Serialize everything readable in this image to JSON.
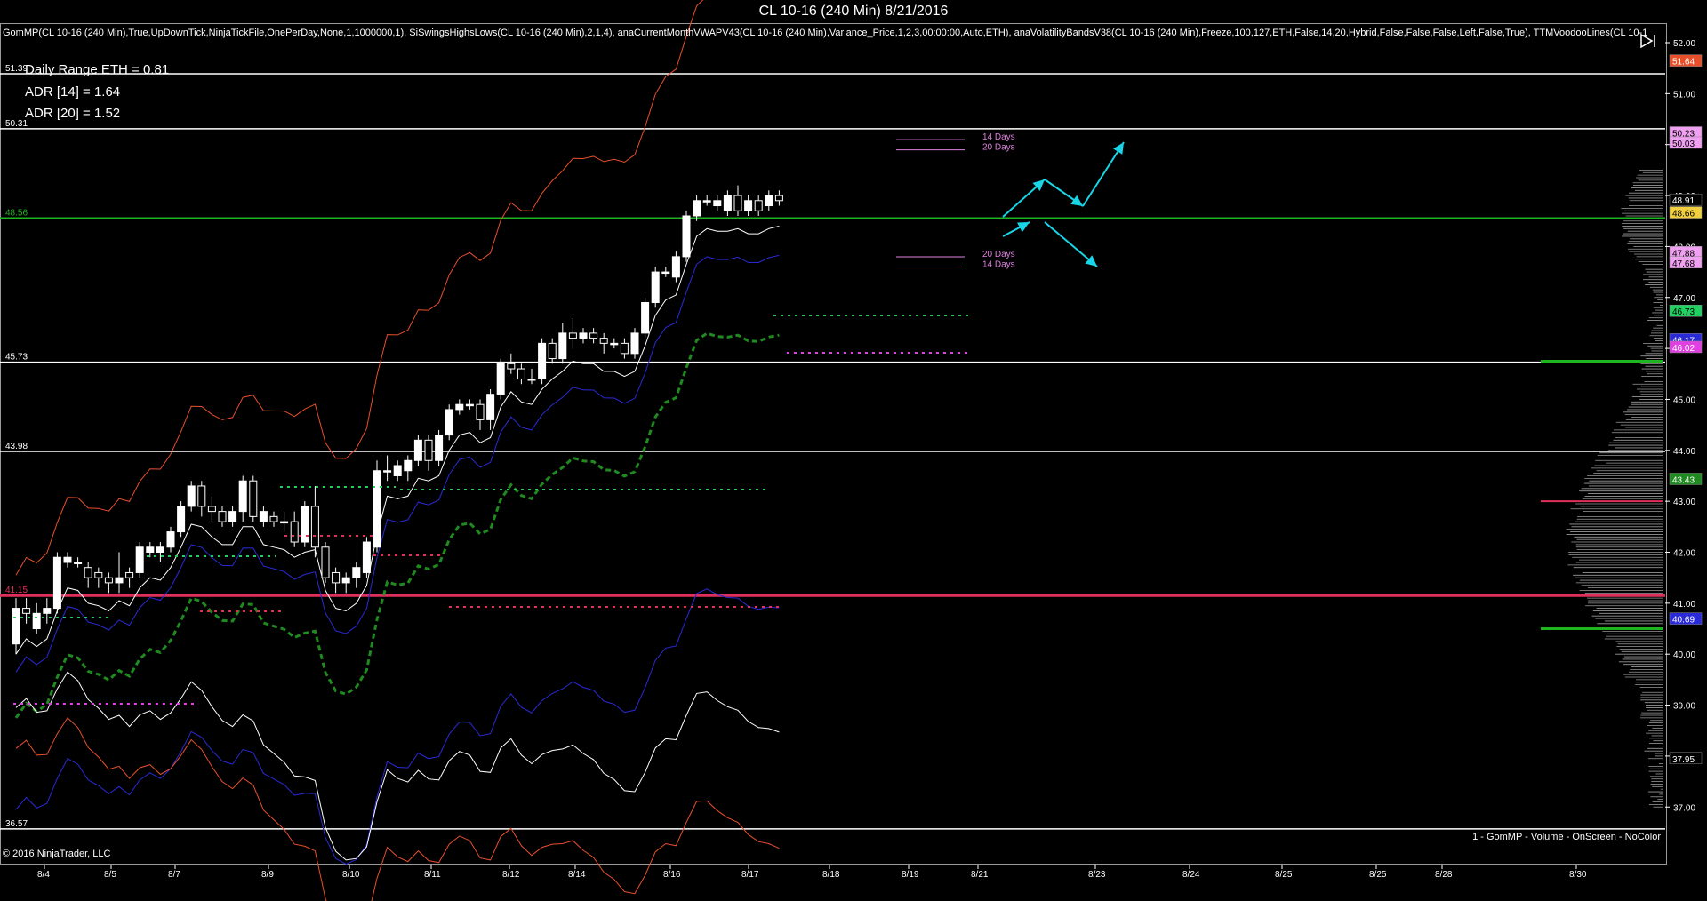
{
  "window": {
    "title": "CL 10-16 (240 Min)  8/21/2016"
  },
  "indicators_text": "GomMP(CL 10-16 (240 Min),True,UpDownTick,NinjaTickFile,OnePerDay,None,1,1000000,1), SiSwingsHighsLows(CL 10-16 (240 Min),2,1,4), anaCurrentMonthVWAPV43(CL 10-16 (240 Min),Variance_Price,1,2,3,00:00:00,Auto,ETH), anaVolatilityBandsV38(CL 10-16 (240 Min),Freeze,100,127,ETH,False,14,20,Hybrid,False,False,False,Left,False,True), TTMVoodooLines(CL 10-1",
  "stats": {
    "daily_range": "Daily Range ETH = 0.81",
    "adr14": "ADR [14] = 1.64",
    "adr20": "ADR [20] = 1.52"
  },
  "copyright": "© 2016 NinjaTrader, LLC",
  "volume_note": "1 - GomMP - Volume - OnScreen - NoColor",
  "colors": {
    "background": "#000000",
    "upper_band": "#e8502c",
    "inner_band": "#2a2ad8",
    "vwap": "#ffffff",
    "green_dash": "#1f8a1f",
    "red_line": "#e0305a",
    "green_line": "#1fb51f",
    "arrow": "#18d6e8",
    "annot": "#e080e0"
  },
  "chart_data": {
    "type": "candlestick",
    "title": "CL 10-16 (240 Min)  8/21/2016",
    "ylim": [
      36.6,
      52.4
    ],
    "y_ticks": [
      "52.00",
      "51.00",
      "50.00",
      "49.00",
      "48.00",
      "47.00",
      "46.00",
      "45.00",
      "44.00",
      "43.00",
      "42.00",
      "41.00",
      "40.00",
      "39.00",
      "38.00",
      "37.00"
    ],
    "x_ticks": [
      "8/4",
      "8/5",
      "8/7",
      "8/9",
      "8/10",
      "8/11",
      "8/12",
      "8/14",
      "8/16",
      "8/17",
      "8/18",
      "8/19",
      "8/21",
      "8/23",
      "8/24",
      "8/25",
      "8/25",
      "8/28",
      "8/30"
    ],
    "candles": [
      [
        40.2,
        40.9,
        40.0,
        41.1
      ],
      [
        40.9,
        40.8,
        40.6,
        41.1
      ],
      [
        40.5,
        40.8,
        40.4,
        41.0
      ],
      [
        40.8,
        40.9,
        40.6,
        41.1
      ],
      [
        40.9,
        41.9,
        40.8,
        42.0
      ],
      [
        41.8,
        41.9,
        41.7,
        42.0
      ],
      [
        41.8,
        41.8,
        41.7,
        41.9
      ],
      [
        41.7,
        41.5,
        41.3,
        41.8
      ],
      [
        41.6,
        41.5,
        41.3,
        41.7
      ],
      [
        41.5,
        41.4,
        41.2,
        41.6
      ],
      [
        41.4,
        41.5,
        41.2,
        42.0
      ],
      [
        41.6,
        41.5,
        41.3,
        41.7
      ],
      [
        41.6,
        42.1,
        41.5,
        42.2
      ],
      [
        42.0,
        42.1,
        41.9,
        42.2
      ],
      [
        42.0,
        42.1,
        41.8,
        42.2
      ],
      [
        42.1,
        42.4,
        42.0,
        42.5
      ],
      [
        42.4,
        42.9,
        42.3,
        43.0
      ],
      [
        42.9,
        43.3,
        42.8,
        43.4
      ],
      [
        43.3,
        42.9,
        42.7,
        43.4
      ],
      [
        42.9,
        42.8,
        42.6,
        43.1
      ],
      [
        42.8,
        42.6,
        42.5,
        42.9
      ],
      [
        42.6,
        42.8,
        42.5,
        42.9
      ],
      [
        42.8,
        43.4,
        42.6,
        43.5
      ],
      [
        43.4,
        42.7,
        42.6,
        43.5
      ],
      [
        42.6,
        42.8,
        42.5,
        42.9
      ],
      [
        42.7,
        42.6,
        42.5,
        42.8
      ],
      [
        42.6,
        42.6,
        42.4,
        42.8
      ],
      [
        42.6,
        42.2,
        42.1,
        42.8
      ],
      [
        42.2,
        42.9,
        42.1,
        43.0
      ],
      [
        42.9,
        42.1,
        41.9,
        43.3
      ],
      [
        42.1,
        41.5,
        41.4,
        42.2
      ],
      [
        41.6,
        41.4,
        41.2,
        41.7
      ],
      [
        41.4,
        41.5,
        41.2,
        41.6
      ],
      [
        41.5,
        41.7,
        41.3,
        41.8
      ],
      [
        41.6,
        42.2,
        41.5,
        42.3
      ],
      [
        42.1,
        43.6,
        42.0,
        43.8
      ],
      [
        43.6,
        43.6,
        43.4,
        43.9
      ],
      [
        43.5,
        43.7,
        43.4,
        43.8
      ],
      [
        43.6,
        43.8,
        43.4,
        43.9
      ],
      [
        43.8,
        44.2,
        43.7,
        44.3
      ],
      [
        44.2,
        43.8,
        43.6,
        44.3
      ],
      [
        43.8,
        44.3,
        43.7,
        44.4
      ],
      [
        44.3,
        44.8,
        44.2,
        44.9
      ],
      [
        44.8,
        44.9,
        44.7,
        45.0
      ],
      [
        44.9,
        44.9,
        44.8,
        45.0
      ],
      [
        44.9,
        44.6,
        44.4,
        45.0
      ],
      [
        44.6,
        45.1,
        44.4,
        45.2
      ],
      [
        45.1,
        45.7,
        45.0,
        45.8
      ],
      [
        45.7,
        45.6,
        45.5,
        45.9
      ],
      [
        45.6,
        45.4,
        45.3,
        45.7
      ],
      [
        45.4,
        45.4,
        45.3,
        45.6
      ],
      [
        45.4,
        46.1,
        45.3,
        46.2
      ],
      [
        46.1,
        45.8,
        45.7,
        46.2
      ],
      [
        45.8,
        46.3,
        45.7,
        46.5
      ],
      [
        46.3,
        46.2,
        46.0,
        46.6
      ],
      [
        46.2,
        46.3,
        46.1,
        46.4
      ],
      [
        46.3,
        46.2,
        46.1,
        46.4
      ],
      [
        46.2,
        46.1,
        45.9,
        46.3
      ],
      [
        46.1,
        46.1,
        46.0,
        46.2
      ],
      [
        46.1,
        45.9,
        45.8,
        46.2
      ],
      [
        45.9,
        46.3,
        45.8,
        46.4
      ],
      [
        46.3,
        46.9,
        46.2,
        47.0
      ],
      [
        46.9,
        47.5,
        46.8,
        47.6
      ],
      [
        47.5,
        47.5,
        47.4,
        47.6
      ],
      [
        47.4,
        47.8,
        47.3,
        47.9
      ],
      [
        47.8,
        48.6,
        47.7,
        48.7
      ],
      [
        48.6,
        48.9,
        48.5,
        49.0
      ],
      [
        48.9,
        48.9,
        48.8,
        49.0
      ],
      [
        48.8,
        48.9,
        48.7,
        49.0
      ],
      [
        48.7,
        49.0,
        48.6,
        49.1
      ],
      [
        49.0,
        48.7,
        48.6,
        49.2
      ],
      [
        48.7,
        48.9,
        48.6,
        49.0
      ],
      [
        48.9,
        48.7,
        48.6,
        49.0
      ],
      [
        48.8,
        49.0,
        48.7,
        49.1
      ],
      [
        49.0,
        48.9,
        48.8,
        49.1
      ]
    ],
    "horizontal_lines": [
      {
        "label": "51.39",
        "value": 51.39,
        "color": "#ffffff"
      },
      {
        "label": "50.31",
        "value": 50.31,
        "color": "#ffffff"
      },
      {
        "label": "48.56",
        "value": 48.56,
        "color": "#1fb51f"
      },
      {
        "label": "45.73",
        "value": 45.73,
        "color": "#ffffff"
      },
      {
        "label": "43.98",
        "value": 43.98,
        "color": "#ffffff"
      },
      {
        "label": "41.15",
        "value": 41.15,
        "color": "#e0305a"
      },
      {
        "label": "36.57",
        "value": 36.57,
        "color": "#ffffff"
      }
    ],
    "price_labels": [
      {
        "text": "51.64",
        "value": 51.64,
        "bg": "#e8502c",
        "fg": "#ffffff"
      },
      {
        "text": "50.23",
        "value": 50.23,
        "bg": "#f0a0f0",
        "fg": "#000000"
      },
      {
        "text": "50.03",
        "value": 50.03,
        "bg": "#f0a0f0",
        "fg": "#000000"
      },
      {
        "text": "48.91",
        "value": 48.91,
        "bg": "#000000",
        "fg": "#ffffff"
      },
      {
        "text": "48.66",
        "value": 48.66,
        "bg": "#f0d040",
        "fg": "#000000"
      },
      {
        "text": "47.88",
        "value": 47.88,
        "bg": "#f0a0f0",
        "fg": "#000000"
      },
      {
        "text": "47.68",
        "value": 47.68,
        "bg": "#f0a0f0",
        "fg": "#000000"
      },
      {
        "text": "46.73",
        "value": 46.73,
        "bg": "#20d060",
        "fg": "#000000"
      },
      {
        "text": "46.17",
        "value": 46.17,
        "bg": "#2a2ad8",
        "fg": "#ffffff"
      },
      {
        "text": "46.02",
        "value": 46.02,
        "bg": "#e040e0",
        "fg": "#ffffff"
      },
      {
        "text": "43.43",
        "value": 43.43,
        "bg": "#1f8a1f",
        "fg": "#ffffff"
      },
      {
        "text": "40.69",
        "value": 40.69,
        "bg": "#2a2ad8",
        "fg": "#ffffff"
      },
      {
        "text": "37.95",
        "value": 37.95,
        "bg": "#000000",
        "fg": "#ffffff"
      }
    ],
    "annotations": [
      {
        "text": "14 Days",
        "value": 50.15
      },
      {
        "text": "20 Days",
        "value": 49.95
      },
      {
        "text": "20 Days",
        "value": 47.85
      },
      {
        "text": "14 Days",
        "value": 47.65
      }
    ]
  }
}
